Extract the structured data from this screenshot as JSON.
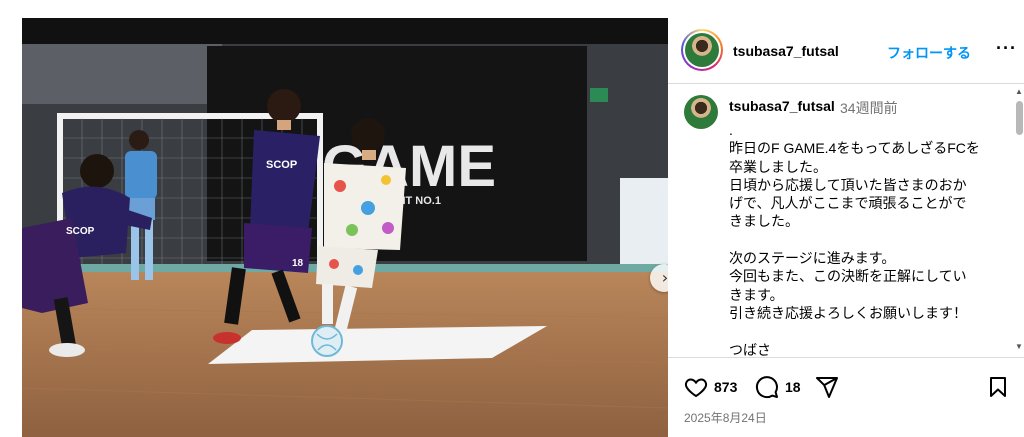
{
  "post": {
    "username": "tsubasa7_futsal",
    "follow_label": "フォローする",
    "more_label": "···",
    "caption": {
      "username": "tsubasa7_futsal",
      "time": "34週間前",
      "lines": [
        ".",
        "昨日のF GAME.4をもってあしざるFCを",
        "卒業しました。",
        "日頃から応援して頂いた皆さまのおか",
        "げで、凡人がここまで頑張ることがで",
        "きました。",
        "",
        "次のステージに進みます。",
        "今回もまた、この決断を正解にしてい",
        "きます。",
        "引き続き応援よろしくお願いします！",
        "",
        "つばさ"
      ]
    },
    "likes": "873",
    "comments": "18",
    "date": "2025年8月24日"
  },
  "photo": {
    "banner_text": "GAME",
    "banner_subtext": "MAKE IT NO.1",
    "jersey_text": "SCOP",
    "jersey_number": "18"
  },
  "icons": {
    "like": "heart-icon",
    "comment": "comment-icon",
    "share": "share-icon",
    "save": "bookmark-icon",
    "next": "chevron-right-icon"
  }
}
